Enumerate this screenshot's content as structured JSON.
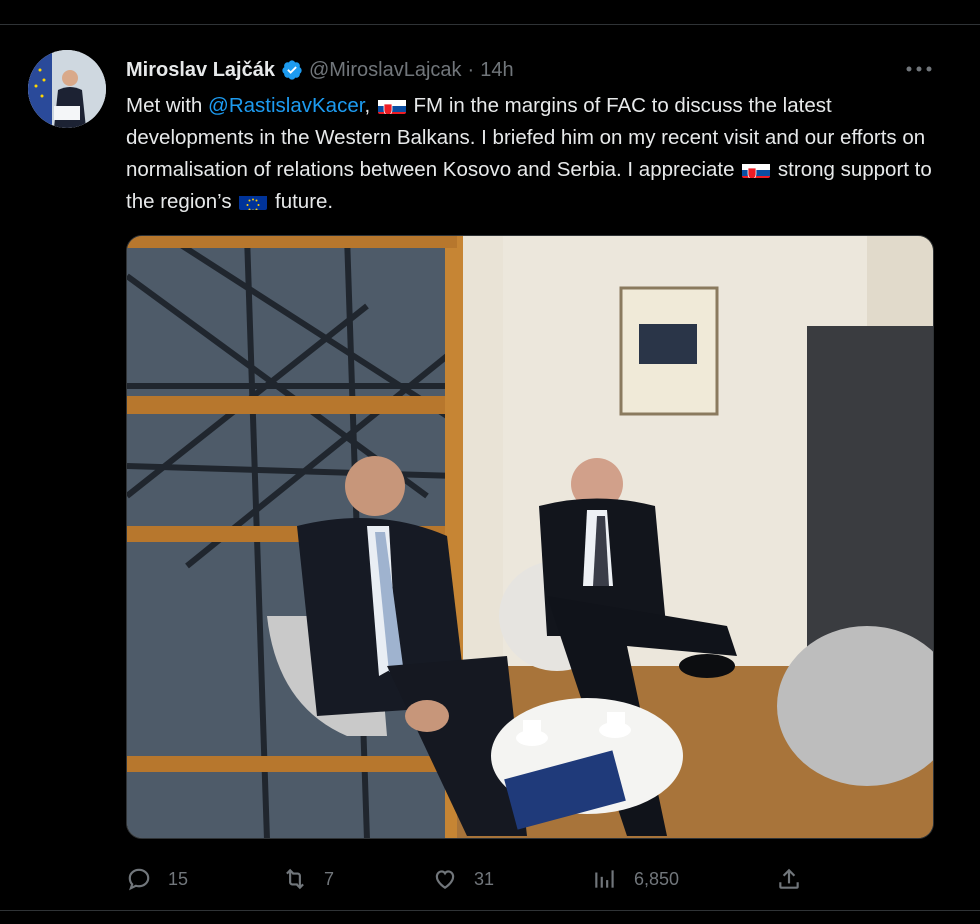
{
  "tweet": {
    "author_name": "Miroslav Lajčák",
    "handle": "@MiroslavLajcak",
    "separator": "·",
    "time": "14h",
    "text_parts": {
      "t1": "Met with ",
      "mention": "@RastislavKacer",
      "t2": ", ",
      "t3": " FM in the margins of FAC to discuss the latest developments in the Western Balkans. I briefed him on my recent visit and our efforts on normalisation of relations between Kosovo and Serbia. I appreciate ",
      "t4": " strong support to the region’s ",
      "t5": " future."
    },
    "emoji": [
      "slovakia-flag",
      "slovakia-flag",
      "eu-flag"
    ]
  },
  "actions": {
    "replies": "15",
    "retweets": "7",
    "likes": "31",
    "views": "6,850"
  },
  "colors": {
    "background": "#000000",
    "text": "#e7e9ea",
    "muted": "#71767b",
    "link": "#1d9bf0",
    "divider": "#2f3336"
  }
}
